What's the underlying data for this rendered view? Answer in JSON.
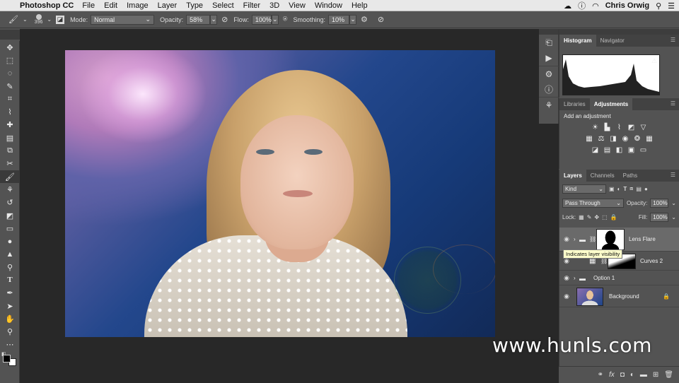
{
  "menubar": {
    "app_name": "Photoshop CC",
    "items": [
      "File",
      "Edit",
      "Image",
      "Layer",
      "Type",
      "Select",
      "Filter",
      "3D",
      "View",
      "Window",
      "Help"
    ],
    "user_name": "Chris Orwig"
  },
  "options": {
    "brush_size": "396",
    "mode_label": "Mode:",
    "mode_value": "Normal",
    "opacity_label": "Opacity:",
    "opacity_value": "58%",
    "flow_label": "Flow:",
    "flow_value": "100%",
    "smoothing_label": "Smoothing:",
    "smoothing_value": "10%"
  },
  "panels": {
    "histogram_tabs": [
      "Histogram",
      "Navigator"
    ],
    "adjust_tabs": [
      "Libraries",
      "Adjustments"
    ],
    "add_adjustment": "Add an adjustment",
    "layers_tabs": [
      "Layers",
      "Channels",
      "Paths"
    ]
  },
  "layers_panel": {
    "kind_label": "Kind",
    "blend_mode": "Pass Through",
    "opacity_label": "Opacity:",
    "opacity_value": "100%",
    "lock_label": "Lock:",
    "fill_label": "Fill:",
    "fill_value": "100%",
    "layers": [
      {
        "name": "Lens Flare"
      },
      {
        "name": "Curves 2"
      },
      {
        "name": "Option 1"
      },
      {
        "name": "Background"
      }
    ],
    "tooltip": "Indicates layer visibility"
  },
  "watermark": "www.hunls.com"
}
